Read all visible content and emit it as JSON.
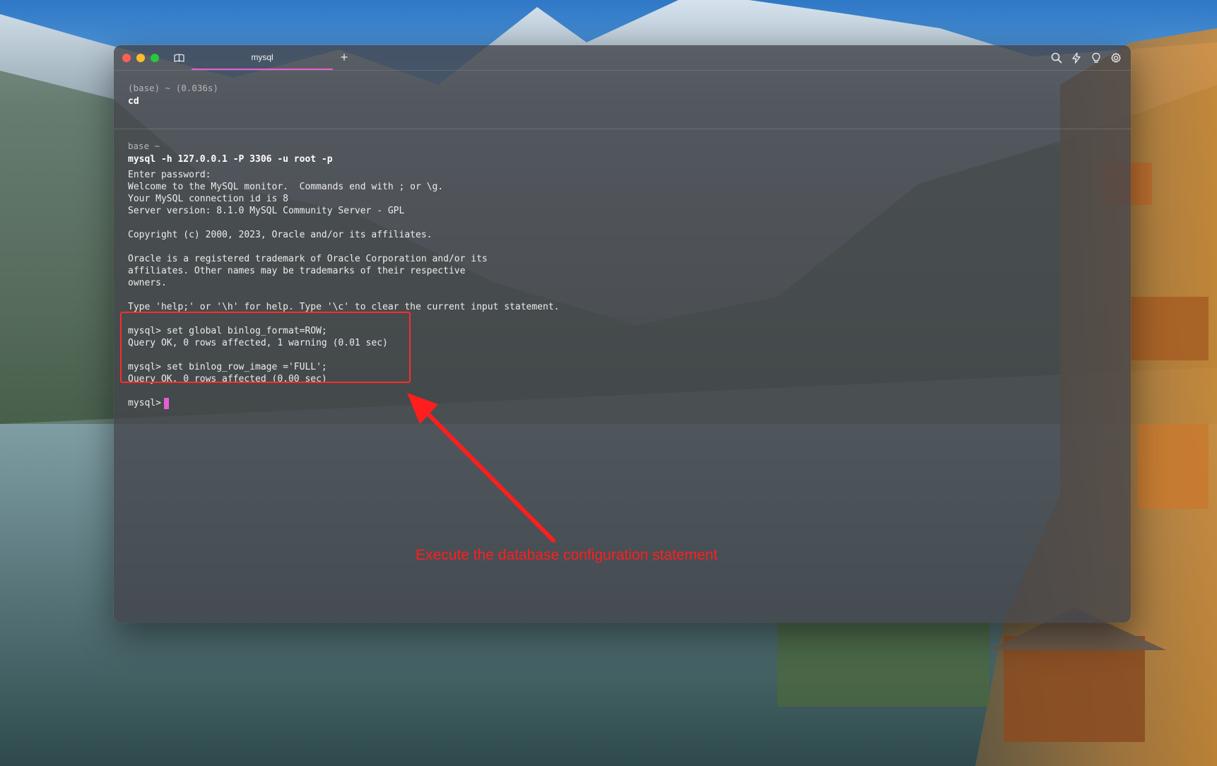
{
  "window": {
    "tab_title": "mysql",
    "new_tab_label": "+"
  },
  "icons": {
    "sidebar": "book-icon",
    "search": "search-icon",
    "lightning": "lightning-icon",
    "bulb": "lightbulb-icon",
    "settings": "gear-icon"
  },
  "blocks": [
    {
      "context": "(base) ~ (0.036s)",
      "command": "cd"
    },
    {
      "context": "base ~",
      "command": "mysql -h 127.0.0.1 -P 3306 -u root -p",
      "output": [
        "Enter password:",
        "Welcome to the MySQL monitor.  Commands end with ; or \\g.",
        "Your MySQL connection id is 8",
        "Server version: 8.1.0 MySQL Community Server - GPL",
        "",
        "Copyright (c) 2000, 2023, Oracle and/or its affiliates.",
        "",
        "Oracle is a registered trademark of Oracle Corporation and/or its",
        "affiliates. Other names may be trademarks of their respective",
        "owners.",
        "",
        "Type 'help;' or '\\h' for help. Type '\\c' to clear the current input statement.",
        "",
        "mysql> set global binlog_format=ROW;",
        "Query OK, 0 rows affected, 1 warning (0.01 sec)",
        "",
        "mysql> set binlog_row_image ='FULL';",
        "Query OK, 0 rows affected (0.00 sec)",
        ""
      ],
      "prompt": "mysql>"
    }
  ],
  "annotation": {
    "text": "Execute the database configuration statement",
    "color": "#ff1e1e"
  },
  "colors": {
    "cursor": "#e35fd4",
    "tab_underline": "#e35fd4",
    "highlight": "#ff2b2b"
  }
}
